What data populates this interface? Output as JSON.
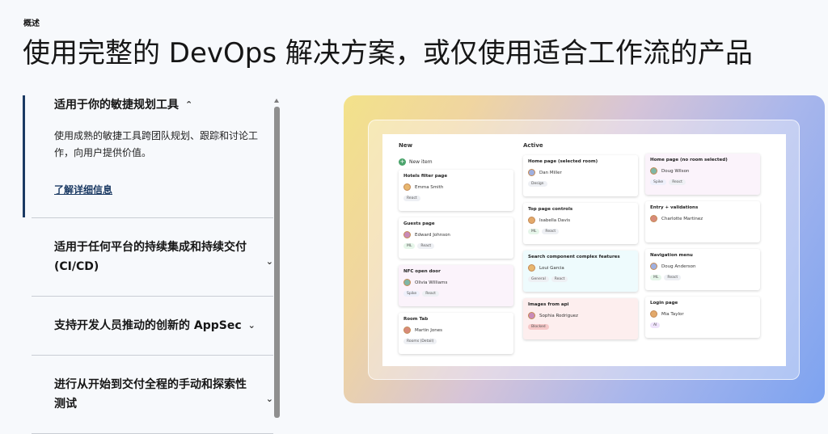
{
  "eyebrow": "概述",
  "headline": "使用完整的 DevOps 解决方案，或仅使用适合工作流的产品",
  "accordion": [
    {
      "title": "适用于你的敏捷规划工具",
      "body": "使用成熟的敏捷工具跨团队规划、跟踪和讨论工作，向用户提供价值。",
      "link": "了解详细信息",
      "chevron": "chevron-up-icon"
    },
    {
      "title": "适用于任何平台的持续集成和持续交付 (CI/CD)",
      "chevron": "chevron-down-icon"
    },
    {
      "title": "支持开发人员推动的创新的 AppSec",
      "chevron": "chevron-down-icon"
    },
    {
      "title": "进行从开始到交付全程的手动和探索性测试",
      "chevron": "chevron-down-icon"
    }
  ],
  "board": {
    "columns": [
      {
        "title": "New",
        "new_item": "New item",
        "cards": [
          {
            "title": "Hotels filter page",
            "person": "Emma Smith",
            "tags": [
              "React"
            ],
            "color": "#ffffff"
          },
          {
            "title": "Guests page",
            "person": "Edward Johnson",
            "tags": [
              "ML",
              "React"
            ],
            "color": "#ffffff"
          },
          {
            "title": "NFC open door",
            "person": "Olivia Williams",
            "tags": [
              "Spike",
              "React"
            ],
            "color": "#fbf3fb"
          },
          {
            "title": "Room Tab",
            "person": "Martin Jones",
            "tags": [
              "Rooms (Detail)"
            ],
            "color": "#ffffff"
          }
        ]
      },
      {
        "title": "Active",
        "cards": [
          {
            "title": "Home page (selected room)",
            "person": "Dan Miller",
            "tags": [
              "Design"
            ],
            "color": "#ffffff"
          },
          {
            "title": "Top page controls",
            "person": "Isabella Davis",
            "tags": [
              "ML",
              "React"
            ],
            "color": "#ffffff"
          },
          {
            "title": "Search component complex features",
            "person": "Loui Garcia",
            "tags": [
              "General",
              "React"
            ],
            "color": "#eefbfd"
          },
          {
            "title": "Images from api",
            "person": "Sophia Rodriguez",
            "tags": [
              "Blocked"
            ],
            "color": "#fdeeee"
          }
        ]
      },
      {
        "title": "",
        "cards": [
          {
            "title": "Home page (no room selected)",
            "person": "Doug Wilson",
            "tags": [
              "Spike",
              "React"
            ],
            "color": "#fbf3fb"
          },
          {
            "title": "Entry + validations",
            "person": "Charlotte Martinez",
            "tags": [],
            "color": "#ffffff"
          },
          {
            "title": "Navigation menu",
            "person": "Doug Anderson",
            "tags": [
              "ML",
              "React"
            ],
            "color": "#ffffff"
          },
          {
            "title": "Login page",
            "person": "Mia Taylor",
            "tags": [
              "AI"
            ],
            "color": "#ffffff"
          }
        ]
      }
    ]
  }
}
